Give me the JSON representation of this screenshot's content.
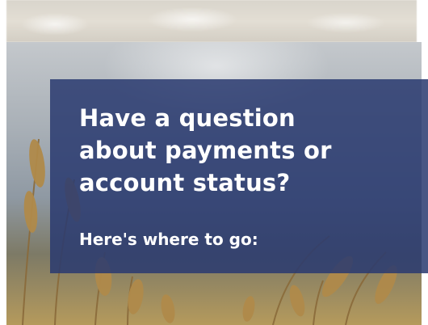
{
  "banner": {
    "headline_lines": [
      "Have a question",
      "about payments or",
      "account status?"
    ],
    "subheadline": "Here's where to go:",
    "panel_color": "#2a3a70",
    "text_color": "#ffffff",
    "background_image": "wheat-field-photo"
  }
}
